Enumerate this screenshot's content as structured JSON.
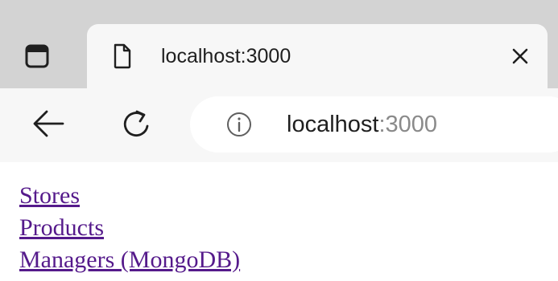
{
  "tab": {
    "title": "localhost:3000"
  },
  "address_bar": {
    "host": "localhost",
    "port": ":3000"
  },
  "page": {
    "links": [
      {
        "label": "Stores"
      },
      {
        "label": "Products"
      },
      {
        "label": "Managers (MongoDB)"
      }
    ]
  },
  "icons": {
    "tab_actions": "tab-actions-menu-icon",
    "tab_page": "page-icon",
    "tab_close": "close-icon",
    "back": "back-arrow-icon",
    "reload": "reload-icon",
    "info": "info-icon"
  },
  "colors": {
    "tab_strip": "#d3d3d3",
    "toolbar": "#f7f7f7",
    "visited_link": "#551a8b"
  }
}
